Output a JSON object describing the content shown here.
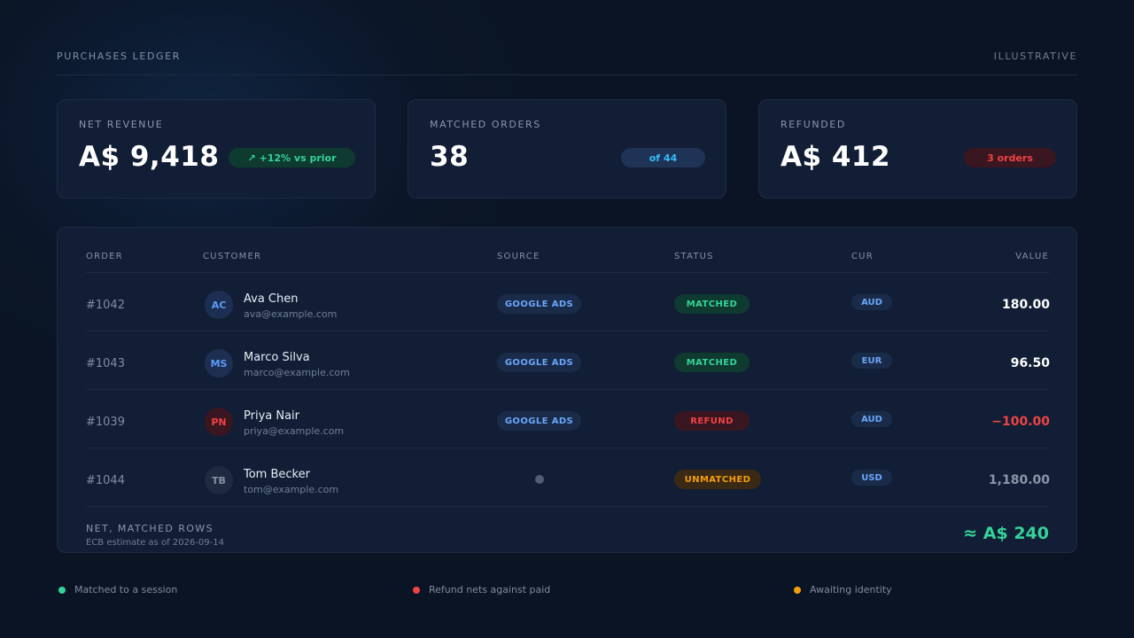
{
  "header": {
    "title": "PURCHASES LEDGER",
    "tag": "ILLUSTRATIVE"
  },
  "cards": [
    {
      "label": "NET REVENUE",
      "value": "A$ 9,418",
      "pill": "↗ +12% vs prior"
    },
    {
      "label": "MATCHED ORDERS",
      "value": "38",
      "pill": "of 44"
    },
    {
      "label": "REFUNDED",
      "value": "A$ 412",
      "pill": "3 orders"
    }
  ],
  "table": {
    "columns": {
      "order": "ORDER",
      "customer": "CUSTOMER",
      "source": "SOURCE",
      "status": "STATUS",
      "cur": "CUR",
      "value": "VALUE"
    },
    "rows": [
      {
        "order": "#1042",
        "initials": "AC",
        "name": "Ava Chen",
        "email": "ava@example.com",
        "source": "GOOGLE ADS",
        "status": "MATCHED",
        "cur": "AUD",
        "value": "180.00"
      },
      {
        "order": "#1043",
        "initials": "MS",
        "name": "Marco Silva",
        "email": "marco@example.com",
        "source": "GOOGLE ADS",
        "status": "MATCHED",
        "cur": "EUR",
        "value": "96.50"
      },
      {
        "order": "#1039",
        "initials": "PN",
        "name": "Priya Nair",
        "email": "priya@example.com",
        "source": "GOOGLE ADS",
        "status": "REFUND",
        "cur": "AUD",
        "value": "−100.00"
      },
      {
        "order": "#1044",
        "initials": "TB",
        "name": "Tom Becker",
        "email": "tom@example.com",
        "source": "",
        "status": "UNMATCHED",
        "cur": "USD",
        "value": "1,180.00"
      }
    ],
    "footer": {
      "label": "NET, MATCHED ROWS",
      "sub": "ECB estimate as of 2026-09-14",
      "total": "≈ A$ 240"
    }
  },
  "legend": [
    {
      "label": "Matched to a session",
      "color": "#34d399"
    },
    {
      "label": "Refund nets against paid",
      "color": "#ef4444"
    },
    {
      "label": "Awaiting identity",
      "color": "#f59e0b"
    }
  ],
  "colors": {
    "green": "#34d399",
    "red": "#ef4444",
    "amber": "#f59e0b",
    "blue": "#6aa6f8"
  }
}
